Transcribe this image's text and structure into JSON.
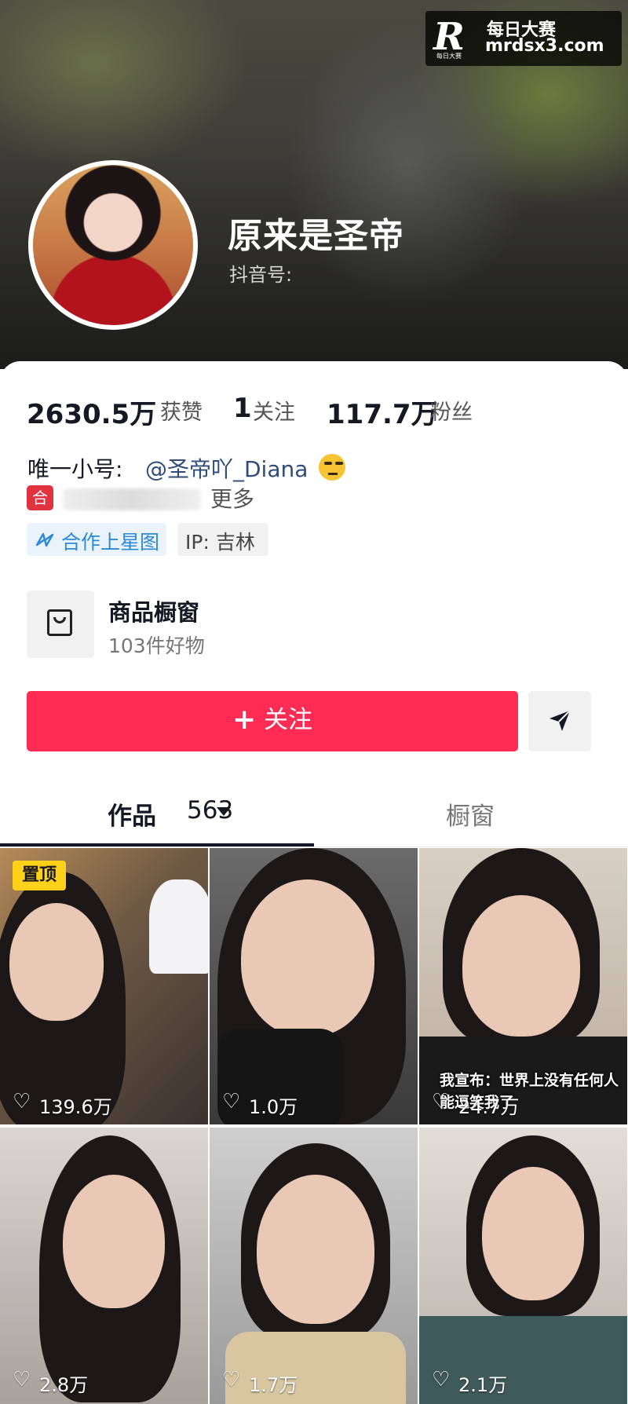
{
  "watermark": {
    "logo": "R",
    "logo_text": "每日大赛",
    "title": "每日大赛",
    "url": "mrdsx3.com"
  },
  "profile": {
    "name": "原来是圣帝",
    "douyin_id_label": "抖音号:"
  },
  "stats": [
    {
      "value": "2630.5万",
      "label": "获赞"
    },
    {
      "value": "1",
      "label": "关注"
    },
    {
      "value": "117.7万",
      "label": "粉丝"
    }
  ],
  "bio": {
    "prefix": "唯一小号:",
    "mention": "@圣帝吖_Diana",
    "badge": "合",
    "more": "更多"
  },
  "tags": {
    "cooperation": "合作上星图",
    "ip": "IP:  吉林"
  },
  "shop": {
    "title": "商品橱窗",
    "subtitle": "103件好物"
  },
  "actions": {
    "follow_plus": "+",
    "follow": "关注"
  },
  "tabs": {
    "works": "作品",
    "works_count": "563",
    "window": "橱窗"
  },
  "grid": {
    "pinned_label": "置顶",
    "items": [
      {
        "likes": "139.6万",
        "pinned": true
      },
      {
        "likes": "1.0万"
      },
      {
        "likes": "24.7万",
        "caption": "我宣布：世界上没有任何人能逗笑我了"
      },
      {
        "likes": "2.8万"
      },
      {
        "likes": "1.7万"
      },
      {
        "likes": "2.1万"
      }
    ]
  },
  "colors": {
    "accent": "#fe2c55",
    "link": "#2f4c7a",
    "tag_blue": "#2b8ad6",
    "pinned": "#ffd11a"
  }
}
